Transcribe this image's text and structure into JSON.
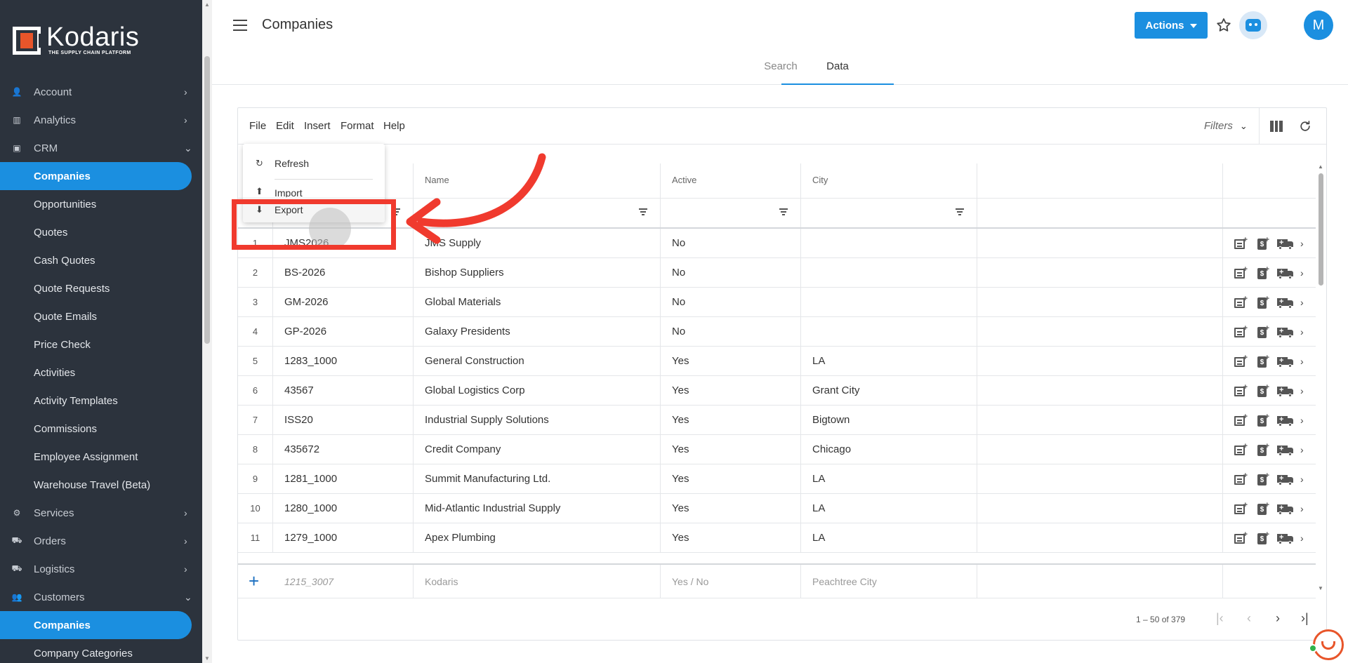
{
  "brand": {
    "name": "Kodaris",
    "tagline": "THE SUPPLY CHAIN PLATFORM",
    "accent": "#1b8fe0",
    "logo_color": "#e8552a"
  },
  "sidebar": {
    "items": [
      {
        "label": "Account",
        "icon": "user-icon",
        "chevron": "›",
        "level": "top"
      },
      {
        "label": "Analytics",
        "icon": "chart-icon",
        "chevron": "›",
        "level": "top"
      },
      {
        "label": "CRM",
        "icon": "briefcase-icon",
        "chevron": "⌄",
        "level": "top"
      },
      {
        "label": "Companies",
        "level": "sub",
        "active": true
      },
      {
        "label": "Opportunities",
        "level": "sub"
      },
      {
        "label": "Quotes",
        "level": "sub"
      },
      {
        "label": "Cash Quotes",
        "level": "sub"
      },
      {
        "label": "Quote Requests",
        "level": "sub"
      },
      {
        "label": "Quote Emails",
        "level": "sub"
      },
      {
        "label": "Price Check",
        "level": "sub"
      },
      {
        "label": "Activities",
        "level": "sub"
      },
      {
        "label": "Activity Templates",
        "level": "sub"
      },
      {
        "label": "Commissions",
        "level": "sub"
      },
      {
        "label": "Employee Assignment",
        "level": "sub"
      },
      {
        "label": "Warehouse Travel (Beta)",
        "level": "sub"
      },
      {
        "label": "Services",
        "icon": "gears-icon",
        "chevron": "›",
        "level": "top"
      },
      {
        "label": "Orders",
        "icon": "truck-icon",
        "chevron": "›",
        "level": "top"
      },
      {
        "label": "Logistics",
        "icon": "shipping-icon",
        "chevron": "›",
        "level": "top"
      },
      {
        "label": "Customers",
        "icon": "people-icon",
        "chevron": "⌄",
        "level": "top"
      },
      {
        "label": "Companies",
        "level": "sub",
        "active": true
      },
      {
        "label": "Company Categories",
        "level": "sub"
      }
    ]
  },
  "header": {
    "title": "Companies",
    "actions_label": "Actions",
    "avatar_initial": "M",
    "tabs": [
      {
        "label": "Search",
        "active": false
      },
      {
        "label": "Data",
        "active": true
      }
    ]
  },
  "toolbar": {
    "menus": [
      "File",
      "Edit",
      "Insert",
      "Format",
      "Help"
    ],
    "filters_label": "Filters"
  },
  "file_menu": {
    "items": [
      {
        "label": "Refresh",
        "icon": "refresh-icon"
      },
      {
        "label": "Import",
        "icon": "upload-icon"
      },
      {
        "label": "Export",
        "icon": "download-icon"
      }
    ]
  },
  "grid": {
    "columns": [
      "",
      "Name",
      "Active",
      "City"
    ],
    "rows": [
      {
        "n": "1",
        "code": "JMS2026",
        "name": "JMS Supply",
        "active": "No",
        "city": ""
      },
      {
        "n": "2",
        "code": "BS-2026",
        "name": "Bishop Suppliers",
        "active": "No",
        "city": ""
      },
      {
        "n": "3",
        "code": "GM-2026",
        "name": "Global Materials",
        "active": "No",
        "city": ""
      },
      {
        "n": "4",
        "code": "GP-2026",
        "name": "Galaxy Presidents",
        "active": "No",
        "city": ""
      },
      {
        "n": "5",
        "code": "1283_1000",
        "name": "General Construction",
        "active": "Yes",
        "city": "LA"
      },
      {
        "n": "6",
        "code": "43567",
        "name": "Global Logistics Corp",
        "active": "Yes",
        "city": "Grant City"
      },
      {
        "n": "7",
        "code": "ISS20",
        "name": "Industrial Supply Solutions",
        "active": "Yes",
        "city": "Bigtown"
      },
      {
        "n": "8",
        "code": "435672",
        "name": "Credit Company",
        "active": "Yes",
        "city": "Chicago"
      },
      {
        "n": "9",
        "code": "1281_1000",
        "name": "Summit Manufacturing Ltd.",
        "active": "Yes",
        "city": "LA"
      },
      {
        "n": "10",
        "code": "1280_1000",
        "name": "Mid-Atlantic Industrial Supply",
        "active": "Yes",
        "city": "LA"
      },
      {
        "n": "11",
        "code": "1279_1000",
        "name": "Apex Plumbing",
        "active": "Yes",
        "city": "LA"
      }
    ],
    "new_row": {
      "code": "1215_3007",
      "name": "Kodaris",
      "active": "Yes / No",
      "city": "Peachtree City"
    },
    "pager_text": "1 – 50 of 379"
  },
  "annotation": {
    "color": "#f03a2e"
  }
}
